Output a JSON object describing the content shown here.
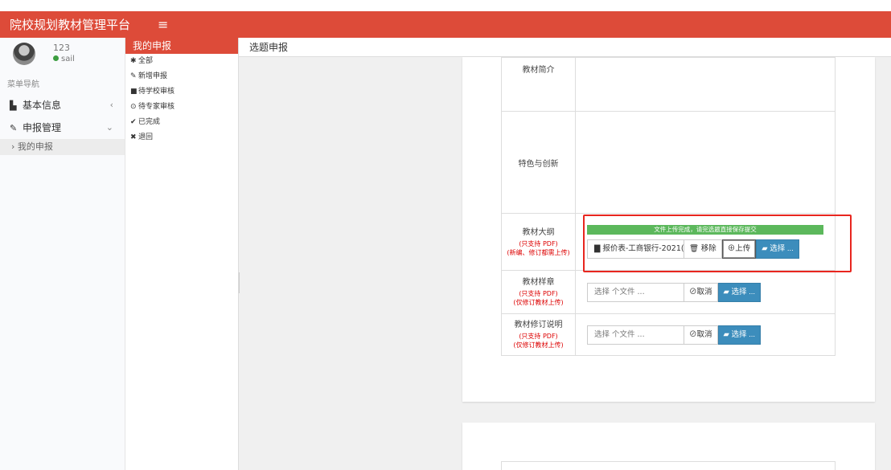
{
  "app": {
    "title": "院校规划教材管理平台"
  },
  "user": {
    "name": "123",
    "status": "sail"
  },
  "nav": {
    "header": "菜单导航",
    "items": [
      {
        "label": "基本信息",
        "icon": "id-card-icon"
      },
      {
        "label": "申报管理",
        "icon": "pencil-icon"
      }
    ],
    "sub_items": [
      {
        "label": "我的申报"
      }
    ]
  },
  "mid": {
    "header": "我的申报",
    "items": [
      {
        "label": "全部",
        "icon": "asterisk-icon"
      },
      {
        "label": "新增申报",
        "icon": "pencil-icon"
      },
      {
        "label": "待学校审核",
        "icon": "lock-icon"
      },
      {
        "label": "待专家审核",
        "icon": "clock-icon"
      },
      {
        "label": "已完成",
        "icon": "check-icon"
      },
      {
        "label": "退回",
        "icon": "cross-icon"
      }
    ]
  },
  "tab": {
    "title": "选题申报"
  },
  "form": {
    "intro_label": "教材简介",
    "feature_label": "特色与创新",
    "outline": {
      "label": "教材大纲",
      "note1": "(只支持 PDF)",
      "note2": "(新编、修订都需上传)",
      "progress_text": "文件上传完成，请完选题直接保存提交",
      "file_name": "报价表-工商银行-2021(",
      "remove_label": "移除",
      "upload_label": "上传",
      "choose_label": "选择 ..."
    },
    "sample": {
      "label": "教材样章",
      "note1": "(只支持 PDF)",
      "note2": "(仅修订教材上传)",
      "placeholder": "选择 个文件 ...",
      "cancel_label": "取消",
      "choose_label": "选择 ..."
    },
    "revision": {
      "label": "教材修订说明",
      "note1": "(只支持 PDF)",
      "note2": "(仅修订教材上传)",
      "placeholder": "选择 个文件 ...",
      "cancel_label": "取消",
      "choose_label": "选择 ..."
    }
  },
  "colors": {
    "brand": "#dd4b39",
    "primary": "#3c8dbc",
    "success": "#5cb85c",
    "highlight": "#e8261f"
  }
}
